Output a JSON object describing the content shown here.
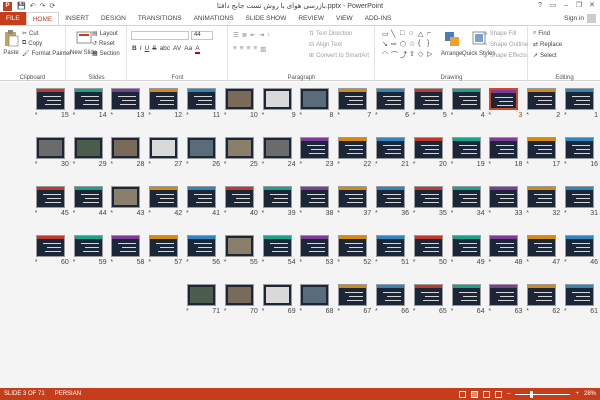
{
  "titlebar": {
    "app_icon": "P",
    "qat": [
      "💾",
      "↶",
      "↷",
      "⟳"
    ],
    "title": "بازرسی هوای با روش تست جابج دافتا.pptx - PowerPoint",
    "controls": [
      "?",
      "▭",
      "–",
      "❐",
      "✕"
    ]
  },
  "tabs": {
    "items": [
      "FILE",
      "HOME",
      "INSERT",
      "DESIGN",
      "TRANSITIONS",
      "ANIMATIONS",
      "SLIDE SHOW",
      "REVIEW",
      "VIEW",
      "ADD-INS"
    ],
    "active": "HOME",
    "signin": "Sign in"
  },
  "ribbon": {
    "clipboard": {
      "label": "Clipboard",
      "paste": "Paste",
      "cut": "Cut",
      "copy": "Copy",
      "format_painter": "Format Painter"
    },
    "slides": {
      "label": "Slides",
      "new_slide": "New Slide",
      "layout": "Layout",
      "reset": "Reset",
      "section": "Section"
    },
    "font": {
      "label": "Font",
      "size_value": "44",
      "format_buttons": [
        "B",
        "I",
        "U",
        "S",
        "abc",
        "AV",
        "Aa",
        "A"
      ]
    },
    "paragraph": {
      "label": "Paragraph",
      "text_direction": "Text Direction",
      "align_text": "Align Text",
      "convert_smartart": "Convert to SmartArt"
    },
    "drawing": {
      "label": "Drawing",
      "arrange": "Arrange",
      "quick_styles": "Quick Styles",
      "shape_fill": "Shape Fill",
      "shape_outline": "Shape Outline",
      "shape_effects": "Shape Effects",
      "shapes": [
        "▭",
        "╲",
        "□",
        "○",
        "△",
        "⌐",
        "↘",
        "⇨",
        "⬡",
        "☆",
        "{",
        "}",
        "◠",
        "⌒",
        "⤴",
        "⇧",
        "◇",
        "▷"
      ]
    },
    "editing": {
      "label": "Editing",
      "find": "Find",
      "replace": "Replace",
      "select": "Select"
    }
  },
  "sorter": {
    "star": "*",
    "selected": 3,
    "total": 71,
    "photo_slides": [
      8,
      9,
      10,
      24,
      25,
      26,
      27,
      28,
      29,
      30,
      43,
      55,
      68,
      69,
      70,
      71
    ]
  },
  "statusbar": {
    "slide_info": "SLIDE 3 OF 71",
    "language": "PERSIAN",
    "zoom": "28%",
    "zoom_fraction": 0.28
  },
  "colors": {
    "accent": "#c43e1c",
    "slide_bg": "#1b2738",
    "selected_border": "#d24726"
  }
}
